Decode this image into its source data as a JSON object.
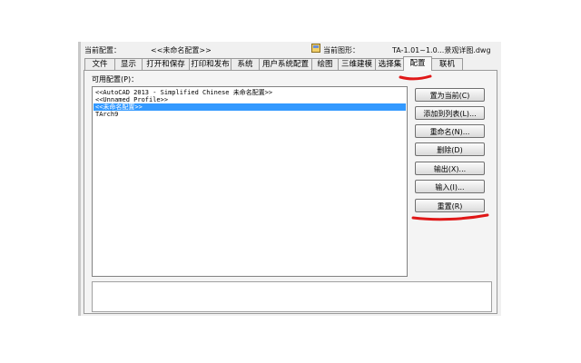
{
  "header": {
    "current_profile_label": "当前配置：",
    "current_profile_value": "<<未命名配置>>",
    "current_drawing_label": "当前图形：",
    "current_drawing_value": "TA-1.01~1.0...景观详图.dwg"
  },
  "tabs": [
    {
      "label": "文件"
    },
    {
      "label": "显示"
    },
    {
      "label": "打开和保存"
    },
    {
      "label": "打印和发布"
    },
    {
      "label": "系统"
    },
    {
      "label": "用户系统配置"
    },
    {
      "label": "绘图"
    },
    {
      "label": "三维建模"
    },
    {
      "label": "选择集"
    },
    {
      "label": "配置"
    },
    {
      "label": "联机"
    }
  ],
  "active_tab": "配置",
  "profiles": {
    "label": "可用配置(P)：",
    "items": [
      "<<AutoCAD 2013 - Simplified Chinese 未命名配置>>",
      "<<Unnamed Profile>>",
      "<<未命名配置>>",
      "TArch9"
    ],
    "selected_index": 2
  },
  "buttons": {
    "set_current": "置为当前(C)",
    "add_to_list": "添加到列表(L)...",
    "rename": "重命名(N)...",
    "delete": "删除(D)",
    "export": "输出(X)...",
    "import": "输入(I)...",
    "reset": "重置(R)"
  },
  "colors": {
    "selection": "#3399ff",
    "annotation": "#e01818"
  }
}
